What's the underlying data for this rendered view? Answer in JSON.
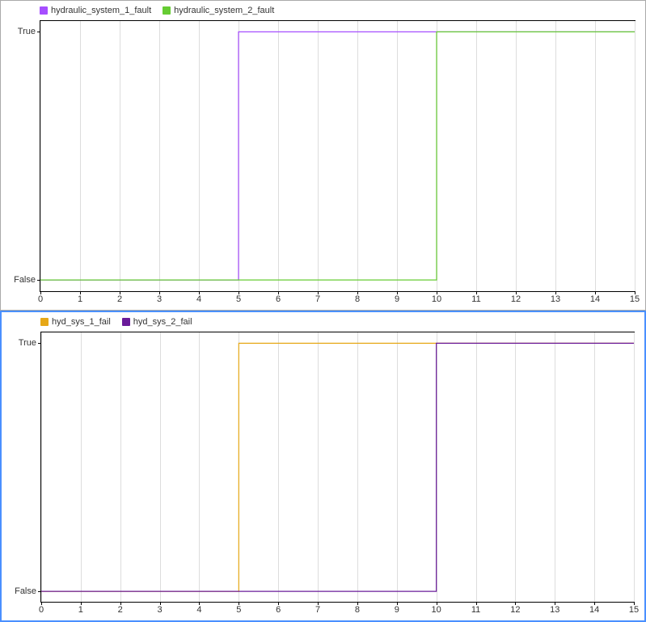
{
  "chart_data": [
    {
      "type": "line",
      "step": true,
      "xlabel": "",
      "ylabel": "",
      "xlim": [
        0,
        15
      ],
      "ylim_categories": [
        "False",
        "True"
      ],
      "x_ticks": [
        0,
        1,
        2,
        3,
        4,
        5,
        6,
        7,
        8,
        9,
        10,
        11,
        12,
        13,
        14,
        15
      ],
      "series": [
        {
          "name": "hydraulic_system_1_fault",
          "color": "#a64eff",
          "data": [
            {
              "x": 0,
              "y": "False"
            },
            {
              "x": 5,
              "y": "False"
            },
            {
              "x": 5,
              "y": "True"
            },
            {
              "x": 15,
              "y": "True"
            }
          ]
        },
        {
          "name": "hydraulic_system_2_fault",
          "color": "#66cc33",
          "data": [
            {
              "x": 0,
              "y": "False"
            },
            {
              "x": 10,
              "y": "False"
            },
            {
              "x": 10,
              "y": "True"
            },
            {
              "x": 15,
              "y": "True"
            }
          ]
        }
      ]
    },
    {
      "type": "line",
      "step": true,
      "xlabel": "",
      "ylabel": "",
      "xlim": [
        0,
        15
      ],
      "ylim_categories": [
        "False",
        "True"
      ],
      "x_ticks": [
        0,
        1,
        2,
        3,
        4,
        5,
        6,
        7,
        8,
        9,
        10,
        11,
        12,
        13,
        14,
        15
      ],
      "series": [
        {
          "name": "hyd_sys_1_fail",
          "color": "#e6a817",
          "data": [
            {
              "x": 0,
              "y": "False"
            },
            {
              "x": 5,
              "y": "False"
            },
            {
              "x": 5,
              "y": "True"
            },
            {
              "x": 15,
              "y": "True"
            }
          ]
        },
        {
          "name": "hyd_sys_2_fail",
          "color": "#6a1b9a",
          "data": [
            {
              "x": 0,
              "y": "False"
            },
            {
              "x": 10,
              "y": "False"
            },
            {
              "x": 10,
              "y": "True"
            },
            {
              "x": 15,
              "y": "True"
            }
          ]
        }
      ]
    }
  ],
  "panels": [
    {
      "selected": false
    },
    {
      "selected": true
    }
  ]
}
